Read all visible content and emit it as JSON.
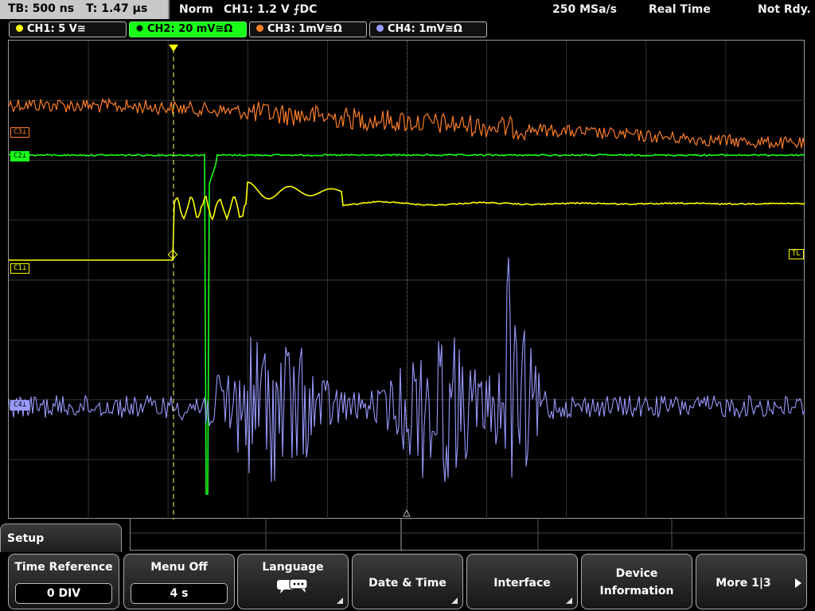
{
  "status": {
    "timebase": "TB: 500 ns",
    "trigger_time": "T: 1.47 µs",
    "mode": "Norm",
    "trigger_setup": "CH1: 1.2 V ⨍DC",
    "sample_rate": "250 MSa/s",
    "acq_mode": "Real Time",
    "state": "Not Rdy."
  },
  "channels": [
    {
      "label": "CH1: 5 V≅",
      "color": "#ffff00",
      "active": false
    },
    {
      "label": "CH2: 20 mV≅Ω",
      "color": "#19ff19",
      "active": true
    },
    {
      "label": "CH3: 1mV≅Ω",
      "color": "#ff7f27",
      "active": false
    },
    {
      "label": "CH4: 1mV≅Ω",
      "color": "#9999ff",
      "active": false
    }
  ],
  "markers": {
    "ch3": "C3⊥",
    "ch2": "C2⊥",
    "ch1": "C1⊥",
    "ch4": "C4⊥",
    "trigger_level": "TL",
    "trigger_pos": "T"
  },
  "menu": {
    "title": "Setup",
    "keys": [
      {
        "label": "Time Reference",
        "value": "0 DIV"
      },
      {
        "label": "Menu Off",
        "value": "4 s"
      },
      {
        "label": "Language",
        "icon": "speech-bubbles-icon"
      },
      {
        "label": "Date & Time"
      },
      {
        "label": "Interface"
      },
      {
        "label": "Device",
        "label2": "Information"
      },
      {
        "label": "More 1|3"
      }
    ]
  },
  "colors": {
    "ch1": "#ffff00",
    "ch2": "#19ff19",
    "ch3": "#ff7f27",
    "ch4": "#9999ff",
    "grid": "#3a3a3a"
  }
}
